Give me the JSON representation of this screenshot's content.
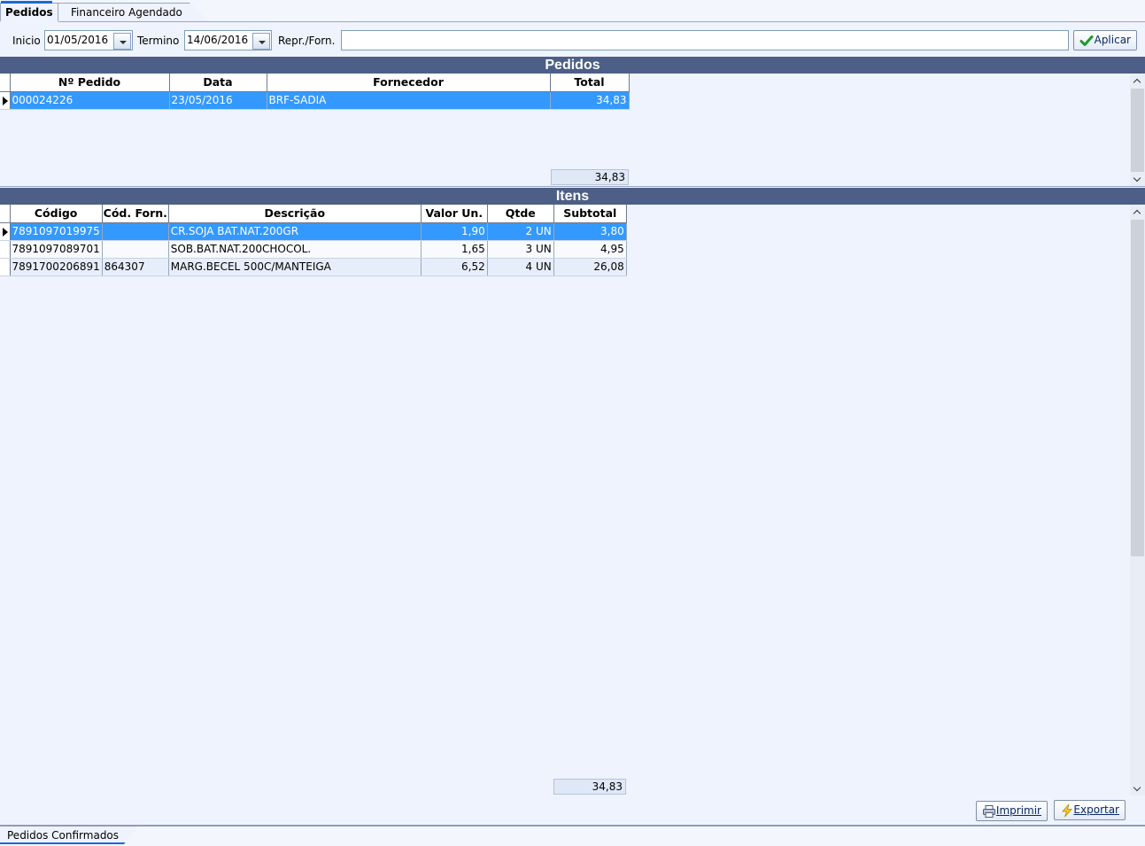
{
  "tabs": [
    {
      "label": "Pedidos",
      "active": true
    },
    {
      "label": "Financeiro Agendado",
      "active": false
    }
  ],
  "filter": {
    "inicio_label": "Inicio",
    "inicio_value": "01/05/2016",
    "termino_label": "Termino",
    "termino_value": "14/06/2016",
    "repr_label": "Repr./Forn.",
    "repr_value": "",
    "apply_label": "Aplicar"
  },
  "pedidos": {
    "title": "Pedidos",
    "columns": [
      "Nº Pedido",
      "Data",
      "Fornecedor",
      "Total"
    ],
    "rows": [
      {
        "numero": "000024226",
        "data": "23/05/2016",
        "fornecedor": "BRF-SADIA",
        "total": "34,83"
      }
    ],
    "sum_total": "34,83"
  },
  "itens": {
    "title": "Itens",
    "columns": [
      "Código",
      "Cód. Forn.",
      "Descrição",
      "Valor Un.",
      "Qtde",
      "Subtotal"
    ],
    "rows": [
      {
        "codigo": "7891097019975",
        "cod_forn": "",
        "descricao": "CR.SOJA BAT.NAT.200GR",
        "valor_un": "1,90",
        "qtde": "2 UN",
        "subtotal": "3,80"
      },
      {
        "codigo": "7891097089701",
        "cod_forn": "",
        "descricao": "SOB.BAT.NAT.200CHOCOL.",
        "valor_un": "1,65",
        "qtde": "3 UN",
        "subtotal": "4,95"
      },
      {
        "codigo": "7891700206891",
        "cod_forn": "864307",
        "descricao": "MARG.BECEL 500C/MANTEIGA",
        "valor_un": "6,52",
        "qtde": "4 UN",
        "subtotal": "26,08"
      }
    ],
    "sum_total": "34,83"
  },
  "actions": {
    "print_label": "Imprimir",
    "export_label": "Exportar"
  },
  "bottom_tabs": [
    {
      "label": "Pedidos Confirmados",
      "active": true
    }
  ],
  "icons": {
    "apply": "check-icon",
    "print": "printer-icon",
    "export": "lightning-icon",
    "date": "chevron-down-icon"
  },
  "colors": {
    "section_header": "#4d5f86",
    "selected_row": "#3399ff",
    "background": "#eef3fd",
    "accent": "#1c68d8"
  }
}
